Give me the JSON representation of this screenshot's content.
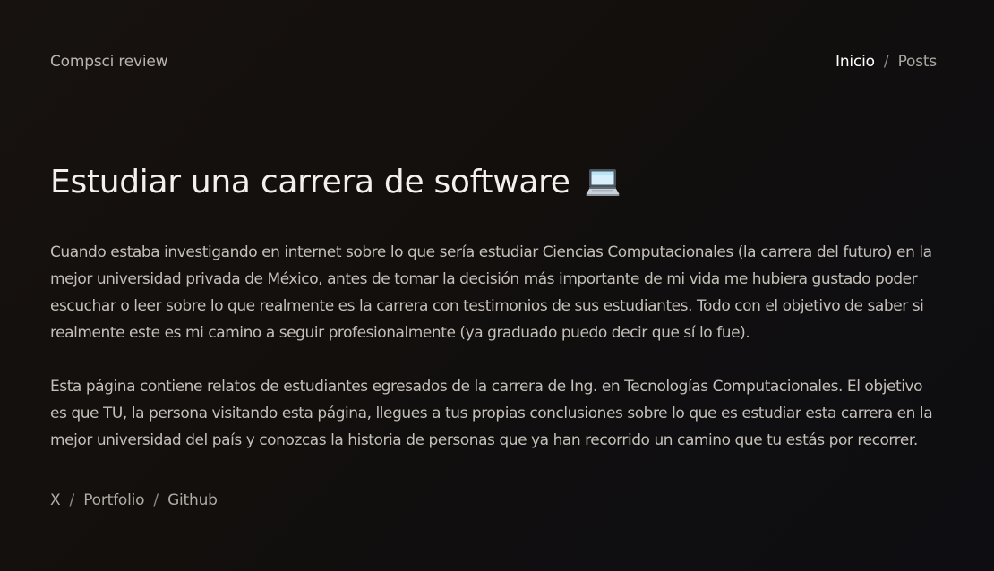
{
  "header": {
    "brand": "Compsci review",
    "nav": {
      "items": [
        {
          "label": "Inicio"
        },
        {
          "label": "Posts"
        }
      ],
      "separator": "/"
    }
  },
  "main": {
    "title": "Estudiar una carrera de software",
    "title_icon": "laptop-icon",
    "paragraphs": [
      "Cuando estaba investigando en internet sobre lo que sería estudiar Ciencias Computacionales (la carrera del futuro) en la mejor universidad privada de México, antes de tomar la decisión más importante de mi vida me hubiera gustado poder escuchar o leer sobre lo que realmente es la carrera con testimonios de sus estudiantes. Todo con el objetivo de saber si realmente este es mi camino a seguir profesionalmente (ya graduado puedo decir que sí lo fue).",
      "Esta página contiene relatos de estudiantes egresados de la carrera de Ing. en Tecnologías Computacionales. El objetivo es que TU, la persona visitando esta página, llegues a tus propias conclusiones sobre lo que es estudiar esta carrera en la mejor universidad del país y conozcas la historia de personas que ya han recorrido un camino que tu estás por recorrer."
    ]
  },
  "footer": {
    "links": [
      {
        "label": "X"
      },
      {
        "label": "Portfolio"
      },
      {
        "label": "Github"
      }
    ],
    "separator": "/"
  },
  "colors": {
    "background": "#141110",
    "title": "#f4f1ec",
    "body_text": "#c4bfb8",
    "nav_active": "#ffffff",
    "nav_muted": "#aaa59f"
  }
}
